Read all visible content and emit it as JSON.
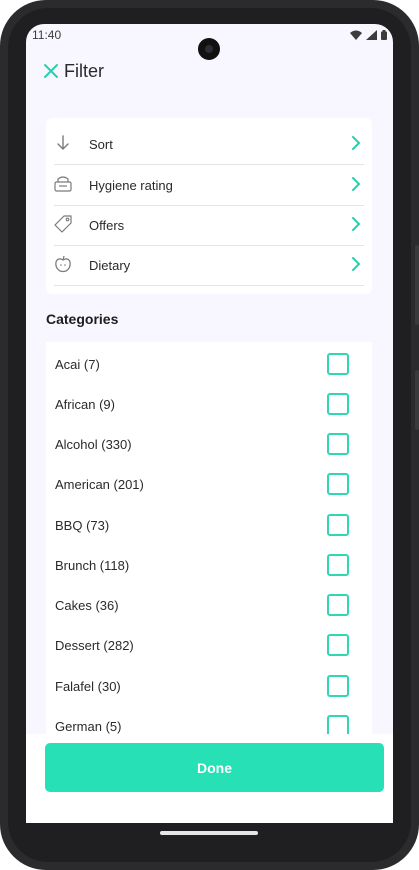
{
  "status_bar": {
    "time": "11:40",
    "icons": [
      "wifi-icon",
      "signal-icon",
      "battery-icon"
    ]
  },
  "header": {
    "title": "Filter",
    "close_icon": "close-icon"
  },
  "filters": [
    {
      "label": "Sort",
      "icon": "sort-arrow-icon"
    },
    {
      "label": "Hygiene rating",
      "icon": "hygiene-icon"
    },
    {
      "label": "Offers",
      "icon": "tag-icon"
    },
    {
      "label": "Dietary",
      "icon": "apple-icon"
    }
  ],
  "categories": {
    "title": "Categories",
    "items": [
      {
        "label": "Acai (7)",
        "checked": false
      },
      {
        "label": "African (9)",
        "checked": false
      },
      {
        "label": "Alcohol (330)",
        "checked": false
      },
      {
        "label": "American (201)",
        "checked": false
      },
      {
        "label": "BBQ (73)",
        "checked": false
      },
      {
        "label": "Brunch (118)",
        "checked": false
      },
      {
        "label": "Cakes (36)",
        "checked": false
      },
      {
        "label": "Dessert (282)",
        "checked": false
      },
      {
        "label": "Falafel (30)",
        "checked": false
      },
      {
        "label": "German (5)",
        "checked": false
      }
    ]
  },
  "footer": {
    "done_label": "Done"
  },
  "colors": {
    "accent": "#27e0b5",
    "checkbox_border": "#2fd8b3",
    "background": "#f8f6ff"
  }
}
